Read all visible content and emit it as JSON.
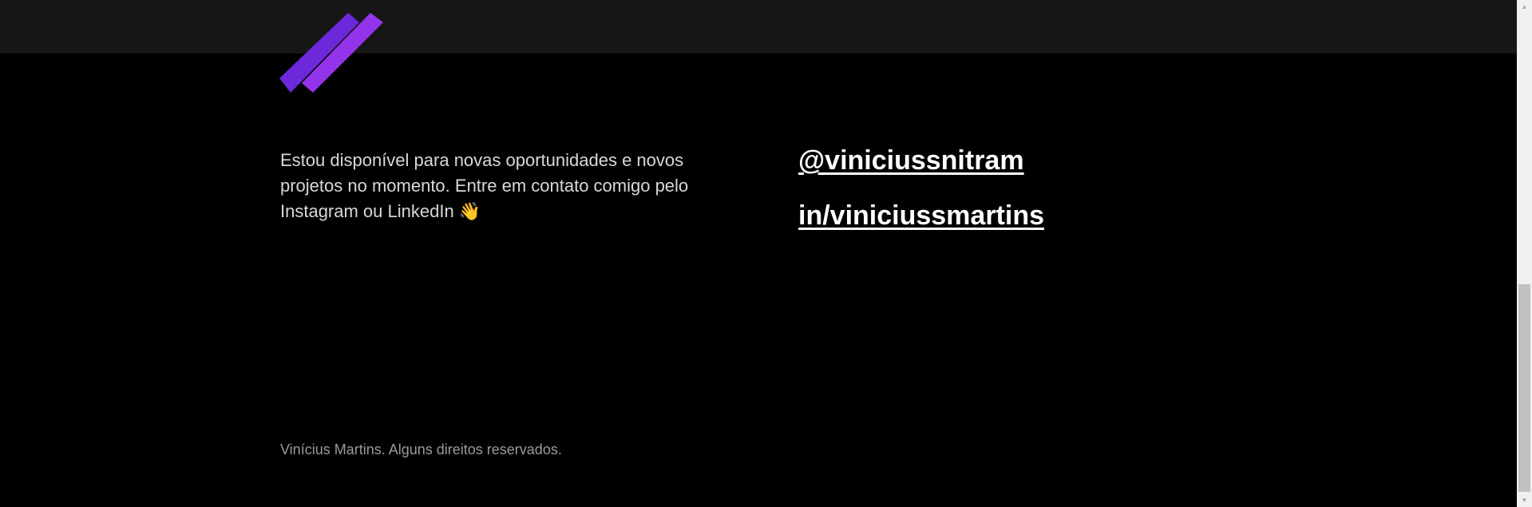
{
  "contact": {
    "message": "Estou disponível para novas oportunidades e novos projetos no momento. Entre em contato comigo pelo Instagram ou LinkedIn",
    "wave_emoji": "👋"
  },
  "social": {
    "instagram_label": "@viniciussnitram",
    "linkedin_label": "in/viniciussmartins"
  },
  "footer": {
    "copyright": "Vinícius Martins. Alguns direitos reservados."
  },
  "scrollbar": {
    "up_arrow": "▲",
    "down_arrow": "▼",
    "position": 0.98
  },
  "logo": {
    "icon": "two-diagonal-stripes-logo",
    "colors": [
      "#6d28d9",
      "#9333ea"
    ]
  }
}
